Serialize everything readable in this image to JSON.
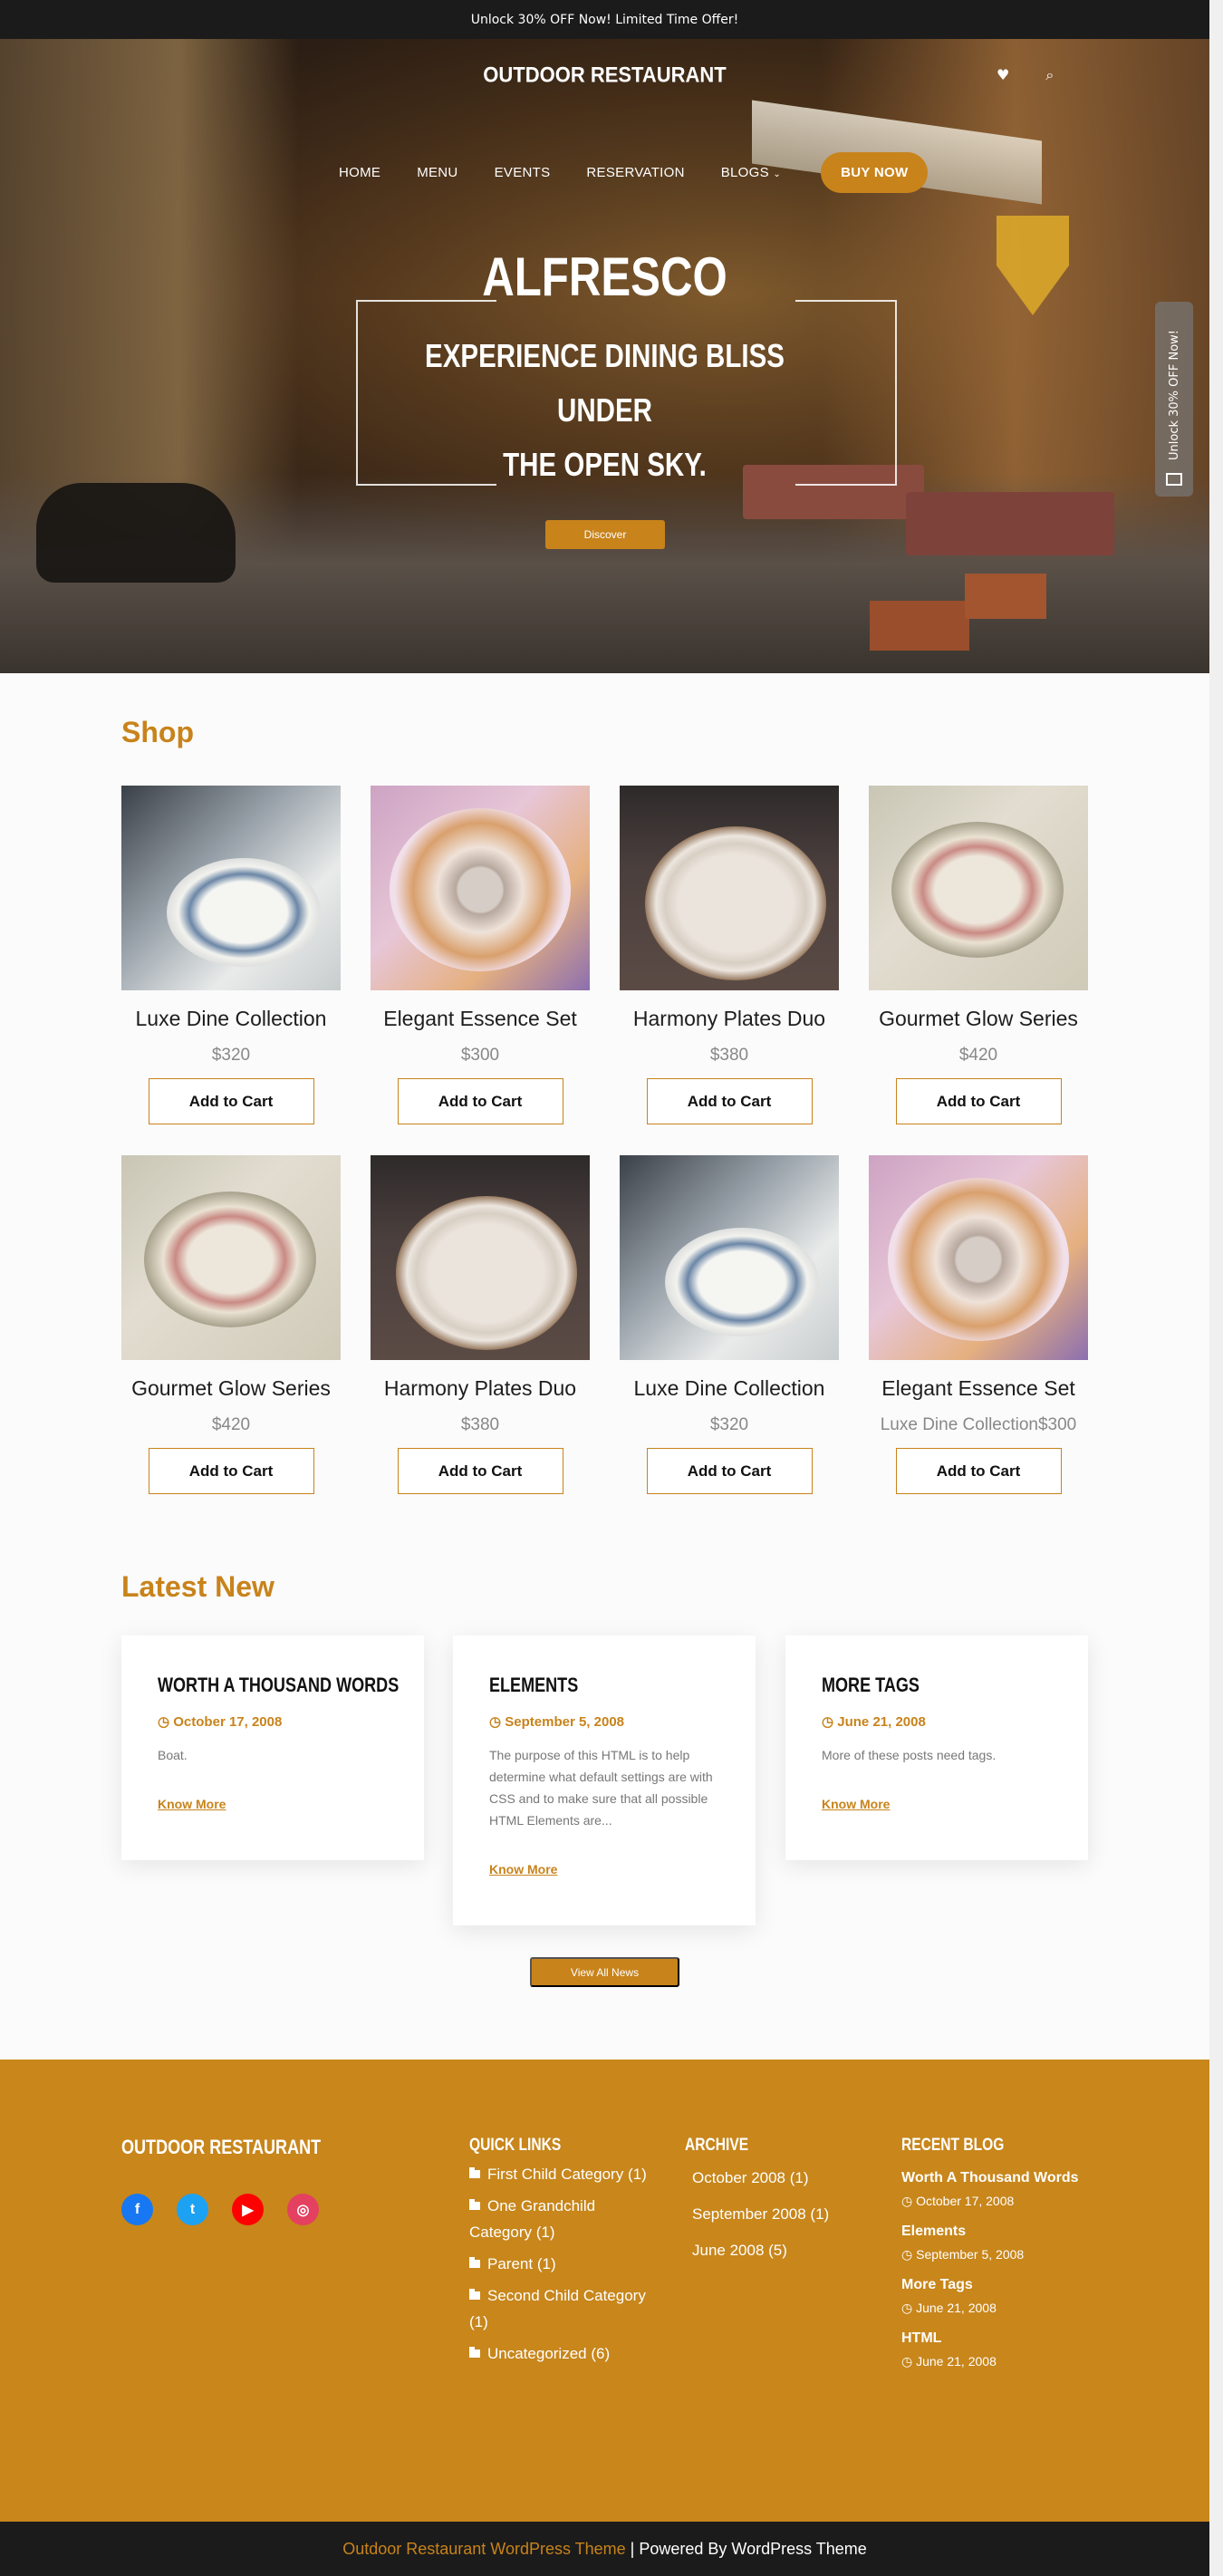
{
  "topbar": {
    "text": "Unlock 30% OFF Now! Limited Time Offer!"
  },
  "header": {
    "brand": "OUTDOOR RESTAURANT",
    "nav": [
      "HOME",
      "MENU",
      "EVENTS",
      "RESERVATION",
      "BLOGS"
    ],
    "buy_label": "BUY NOW"
  },
  "hero": {
    "title": "ALFRESCO",
    "sub1": "EXPERIENCE DINING BLISS",
    "sub2": "UNDER",
    "sub3": "THE OPEN SKY.",
    "cta": "Discover",
    "side_tab": "Unlock 30% OFF Now!"
  },
  "shop": {
    "title": "Shop",
    "cart_label": "Add to Cart",
    "products": [
      {
        "name": "Luxe Dine Collection",
        "price": "$320",
        "img": "luxe"
      },
      {
        "name": "Elegant Essence Set",
        "price": "$300",
        "img": "elegant"
      },
      {
        "name": "Harmony Plates Duo",
        "price": "$380",
        "img": "harmony"
      },
      {
        "name": "Gourmet Glow Series",
        "price": "$420",
        "img": "gourmet"
      },
      {
        "name": "Gourmet Glow Series",
        "price": "$420",
        "img": "gourmet"
      },
      {
        "name": "Harmony Plates Duo",
        "price": "$380",
        "img": "harmony"
      },
      {
        "name": "Luxe Dine Collection",
        "price": "$320",
        "img": "luxe"
      },
      {
        "name": "Elegant Essence Set",
        "price": "Luxe Dine Collection$300",
        "img": "elegant"
      }
    ]
  },
  "news": {
    "title": "Latest New",
    "view_all": "View All News",
    "know_more": "Know More",
    "posts": [
      {
        "title": "WORTH A THOUSAND WORDS",
        "date": "October 17, 2008",
        "excerpt": "Boat."
      },
      {
        "title": "ELEMENTS",
        "date": "September 5, 2008",
        "excerpt": "The purpose of this HTML is to help determine what default settings are with CSS and to make sure that all possible HTML Elements are..."
      },
      {
        "title": "MORE TAGS",
        "date": "June 21, 2008",
        "excerpt": "More of these posts need tags."
      }
    ]
  },
  "footer": {
    "brand": "OUTDOOR RESTAURANT",
    "quick_links_title": "QUICK LINKS",
    "quick_links": [
      {
        "label": "First Child Category",
        "count": "(1)"
      },
      {
        "label": "One Grandchild Category",
        "count": "(1)"
      },
      {
        "label": "Parent",
        "count": "(1)"
      },
      {
        "label": "Second Child Category",
        "count": "(1)"
      },
      {
        "label": "Uncategorized",
        "count": "(6)"
      }
    ],
    "archive_title": "ARCHIVE",
    "archive": [
      "October 2008 (1)",
      "September 2008 (1)",
      "June 2008 (5)"
    ],
    "recent_title": "RECENT BLOG",
    "recent": [
      {
        "title": "Worth A Thousand Words",
        "date": "October 17, 2008"
      },
      {
        "title": "Elements",
        "date": "September 5, 2008"
      },
      {
        "title": "More Tags",
        "date": "June 21, 2008"
      },
      {
        "title": "HTML",
        "date": "June 21, 2008"
      }
    ],
    "socials": [
      {
        "name": "facebook-icon",
        "color": "#1877f2",
        "glyph": "f"
      },
      {
        "name": "twitter-icon",
        "color": "#1da1f2",
        "glyph": "t"
      },
      {
        "name": "youtube-icon",
        "color": "#ff0000",
        "glyph": "▶"
      },
      {
        "name": "instagram-icon",
        "color": "#e4405f",
        "glyph": "◎"
      }
    ]
  },
  "bottom": {
    "link": "Outdoor Restaurant WordPress Theme",
    "rest": " | Powered By WordPress Theme"
  },
  "colors": {
    "accent": "#c8831b",
    "dark": "#1b1b1b"
  }
}
